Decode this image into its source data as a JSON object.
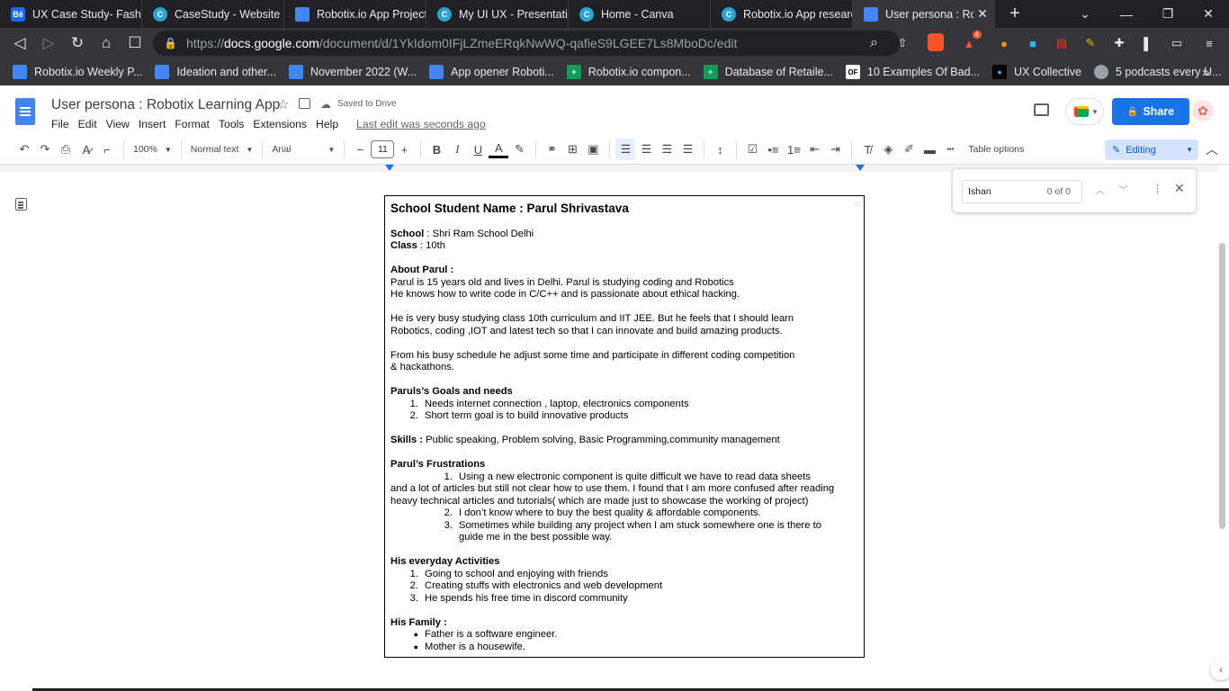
{
  "browser": {
    "tabs": [
      {
        "label": "UX Case Study- Fashion",
        "icon": "behance-icon",
        "fav": "Bē"
      },
      {
        "label": "CaseStudy - Website",
        "icon": "canva-icon",
        "fav": "C"
      },
      {
        "label": "Robotix.io App Project",
        "icon": "docs-icon",
        "fav": ""
      },
      {
        "label": "My UI UX - Presentation",
        "icon": "canva-icon",
        "fav": "C"
      },
      {
        "label": "Home - Canva",
        "icon": "canva-icon",
        "fav": "C"
      },
      {
        "label": "Robotix.io App research",
        "icon": "canva-icon",
        "fav": "C"
      },
      {
        "label": "User persona : Robotix",
        "icon": "docs-icon",
        "fav": "",
        "active": true
      }
    ],
    "new_tab": "+",
    "url_prefix": "https://",
    "url_host": "docs.google.com",
    "url_path": "/document/d/1YkIdom0IFjLZmeERqkNwWQ-qafieS9LGEE7Ls8MboDc/edit",
    "ext_badge": "4",
    "bookmarks": [
      {
        "label": "Robotix.io Weekly P...",
        "color": "#4285f4",
        "t": ""
      },
      {
        "label": "Ideation and other...",
        "color": "#4285f4",
        "t": ""
      },
      {
        "label": "November 2022 (W...",
        "color": "#4285f4",
        "t": ""
      },
      {
        "label": "App opener Roboti...",
        "color": "#4285f4",
        "t": ""
      },
      {
        "label": "Robotix.io compon...",
        "color": "#0f9d58",
        "t": "+"
      },
      {
        "label": "Database of Retaile...",
        "color": "#0f9d58",
        "t": "+"
      },
      {
        "label": "10 Examples Of Bad...",
        "color": "#fff",
        "t": "OF"
      },
      {
        "label": "UX Collective",
        "color": "#000",
        "t": "●"
      },
      {
        "label": "5 podcasts every U...",
        "color": "#9aa0a6",
        "t": ""
      }
    ],
    "bookmarks_more": "»"
  },
  "doc": {
    "title": "User persona : Robotix Learning App",
    "saved": "Saved to Drive",
    "menu": [
      "File",
      "Edit",
      "View",
      "Insert",
      "Format",
      "Tools",
      "Extensions",
      "Help"
    ],
    "last_edit": "Last edit was seconds ago",
    "share": "Share"
  },
  "toolbar": {
    "zoom": "100%",
    "style": "Normal text",
    "font": "Arial",
    "size": "11",
    "table_options": "Table options",
    "mode": "Editing"
  },
  "find": {
    "query": "Ishan",
    "count": "0 of 0"
  },
  "content": {
    "heading": "School Student Name : Parul Shrivastava",
    "school_label": "School",
    "school_value": " : Shri Ram School Delhi",
    "class_label": "Class",
    "class_value": " : 10th",
    "about_label": "About Parul :",
    "about_1": "Parul  is 15 years old and lives in Delhi. Parul is studying coding and Robotics",
    "about_2": "He knows how to write code in C/C++ and is passionate about ethical hacking.",
    "busy_1": "He is very busy studying class 10th curriculum and IIT JEE. But he feels that I should learn",
    "busy_2": "Robotics, coding ,IOT and latest tech so that I can innovate and build amazing products.",
    "sched_1": "From his busy schedule he adjust some time and participate in different coding competition",
    "sched_2": "& hackathons.",
    "goals_label": "Paruls’s Goals and needs",
    "goals": [
      {
        "n": "1.",
        "t": "Needs internet connection , laptop, electronics components"
      },
      {
        "n": "2.",
        "t": "Short term goal is to build innovative products"
      }
    ],
    "skills_label": "Skills :",
    "skills_value": " Public speaking, Problem solving, Basic Programming,community management",
    "frus_label": "Parul’s Frustrations",
    "frus_1n": "1.",
    "frus_1a": "Using a new electronic component is quite difficult we have to read data sheets",
    "frus_1b": "and a lot of articles but still not clear how to use them. I found that I am more confused after reading",
    "frus_1c": "heavy technical articles and tutorials( which are made just to showcase the working of project)",
    "frus_2n": "2.",
    "frus_2": "I don’t know where to buy the best quality & affordable components.",
    "frus_3n": "3.",
    "frus_3a": "Sometimes while building any project when I am stuck somewhere one is there to",
    "frus_3b": "guide me in the best possible way.",
    "activities_label": "His everyday Activities",
    "activities": [
      {
        "n": "1.",
        "t": "Going to school and enjoying with friends"
      },
      {
        "n": "2.",
        "t": "Creating stuffs with electronics and web development"
      },
      {
        "n": "3.",
        "t": "He spends his free time in discord community"
      }
    ],
    "family_label": "His Family :",
    "family": [
      {
        "n": "●",
        "t": "Father is a software engineer."
      },
      {
        "n": "●",
        "t": "Mother is a housewife."
      }
    ]
  }
}
